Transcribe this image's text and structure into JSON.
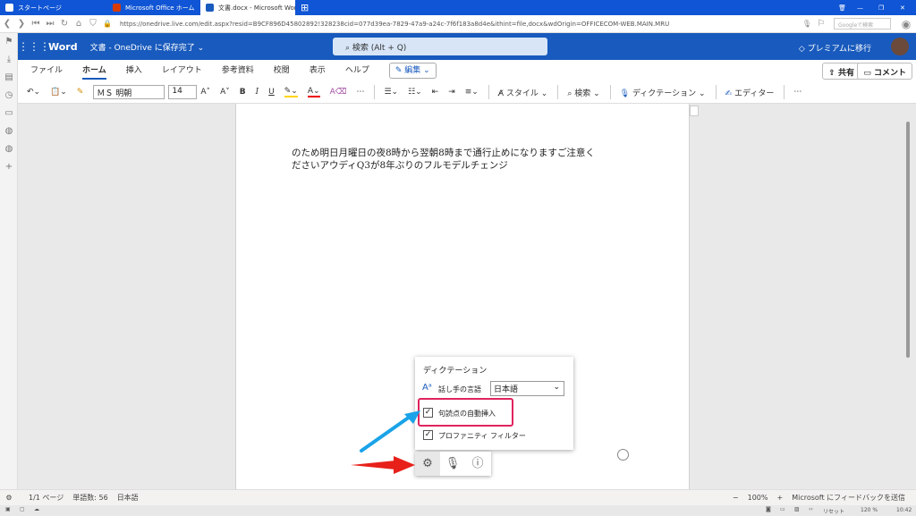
{
  "browser": {
    "tabs": [
      {
        "label": "スタートページ"
      },
      {
        "label": "Microsoft Office ホーム"
      },
      {
        "label": "文書.docx - Microsoft Word"
      }
    ],
    "url": "https://onedrive.live.com/edit.aspx?resid=B9CF896D45802892!328238cid=077d39ea-7829-47a9-a24c-7f6f183a8d4e&ithint=file,docx&wdOrigin=OFFICECOM-WEB.MAIN.MRU",
    "search_placeholder": "Googleで検索"
  },
  "app": {
    "name": "Word",
    "doc_title": "文書 - OneDrive に保存完了 ⌄",
    "search": "検索 (Alt + Q)",
    "premium": "プレミアムに移行"
  },
  "menu": {
    "tabs": [
      "ファイル",
      "ホーム",
      "挿入",
      "レイアウト",
      "参考資料",
      "校閲",
      "表示",
      "ヘルプ"
    ],
    "edit_mode": "編集",
    "share": "共有",
    "comment": "コメント"
  },
  "ribbon": {
    "font": "ＭＳ 明朝",
    "size": "14",
    "style": "スタイル",
    "search": "検索",
    "dictation": "ディクテーション",
    "editor": "エディター"
  },
  "document": {
    "lines": [
      "のため明日月曜日の夜8時から翌朝8時まで通行止めになりますご注意く",
      "ださいアウディQ3が8年ぶりのフルモデルチェンジ"
    ]
  },
  "popup": {
    "title": "ディクテーション",
    "language_label": "話し手の言語",
    "language_value": "日本語",
    "options": [
      {
        "label": "句読点の自動挿入",
        "checked": true
      },
      {
        "label": "プロファニティ フィルター",
        "checked": true
      }
    ]
  },
  "status": {
    "page": "1/1 ページ",
    "words": "単語数: 56",
    "language": "日本語",
    "zoom": "100%",
    "feedback": "Microsoft にフィードバックを送信"
  },
  "window": {
    "reset": "リセット",
    "zoom": "120 %",
    "time": "10:42"
  },
  "colors": {
    "word_blue": "#185abd",
    "browser_blue": "#0f55d5",
    "highlight_box": "#e0245e",
    "arrow_blue": "#1aa3e8",
    "arrow_red": "#e8201a"
  }
}
